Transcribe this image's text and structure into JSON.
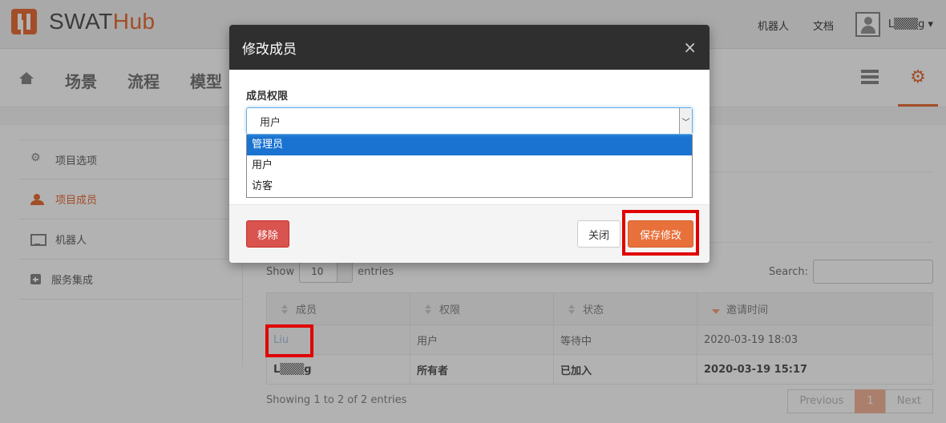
{
  "app": {
    "logo_main": "SWAT",
    "logo_accent": "Hub"
  },
  "topnav": {
    "robots": "机器人",
    "docs": "文档",
    "user": "L▒▒▒g ▾"
  },
  "subnav": {
    "items": [
      "场景",
      "流程",
      "模型"
    ]
  },
  "sidebar": {
    "items": [
      {
        "label": "项目选项"
      },
      {
        "label": "项目成员"
      },
      {
        "label": "机器人"
      },
      {
        "label": "服务集成"
      }
    ]
  },
  "table_controls": {
    "show_label": "Show",
    "page_size": "10",
    "entries_label": "entries",
    "search_label": "Search:"
  },
  "table": {
    "columns": [
      "成员",
      "权限",
      "状态",
      "邀请时间"
    ],
    "rows": [
      {
        "member": "Liu",
        "role": "用户",
        "status": "等待中",
        "invited": "2020-03-19 18:03"
      },
      {
        "member": "L▒▒▒g",
        "role": "所有者",
        "status": "已加入",
        "invited": "2020-03-19 15:17"
      }
    ]
  },
  "pagination": {
    "info": "Showing 1 to 2 of 2 entries",
    "previous": "Previous",
    "current": "1",
    "next": "Next"
  },
  "modal": {
    "title": "修改成员",
    "close": "×",
    "field_label": "成员权限",
    "selected_value": "用户",
    "options": [
      "管理员",
      "用户",
      "访客"
    ],
    "remove_button": "移除",
    "close_button": "关闭",
    "save_button": "保存修改"
  },
  "colors": {
    "accent": "#e8703a",
    "highlight": "#e00000",
    "selected_option": "#1a73d0"
  }
}
